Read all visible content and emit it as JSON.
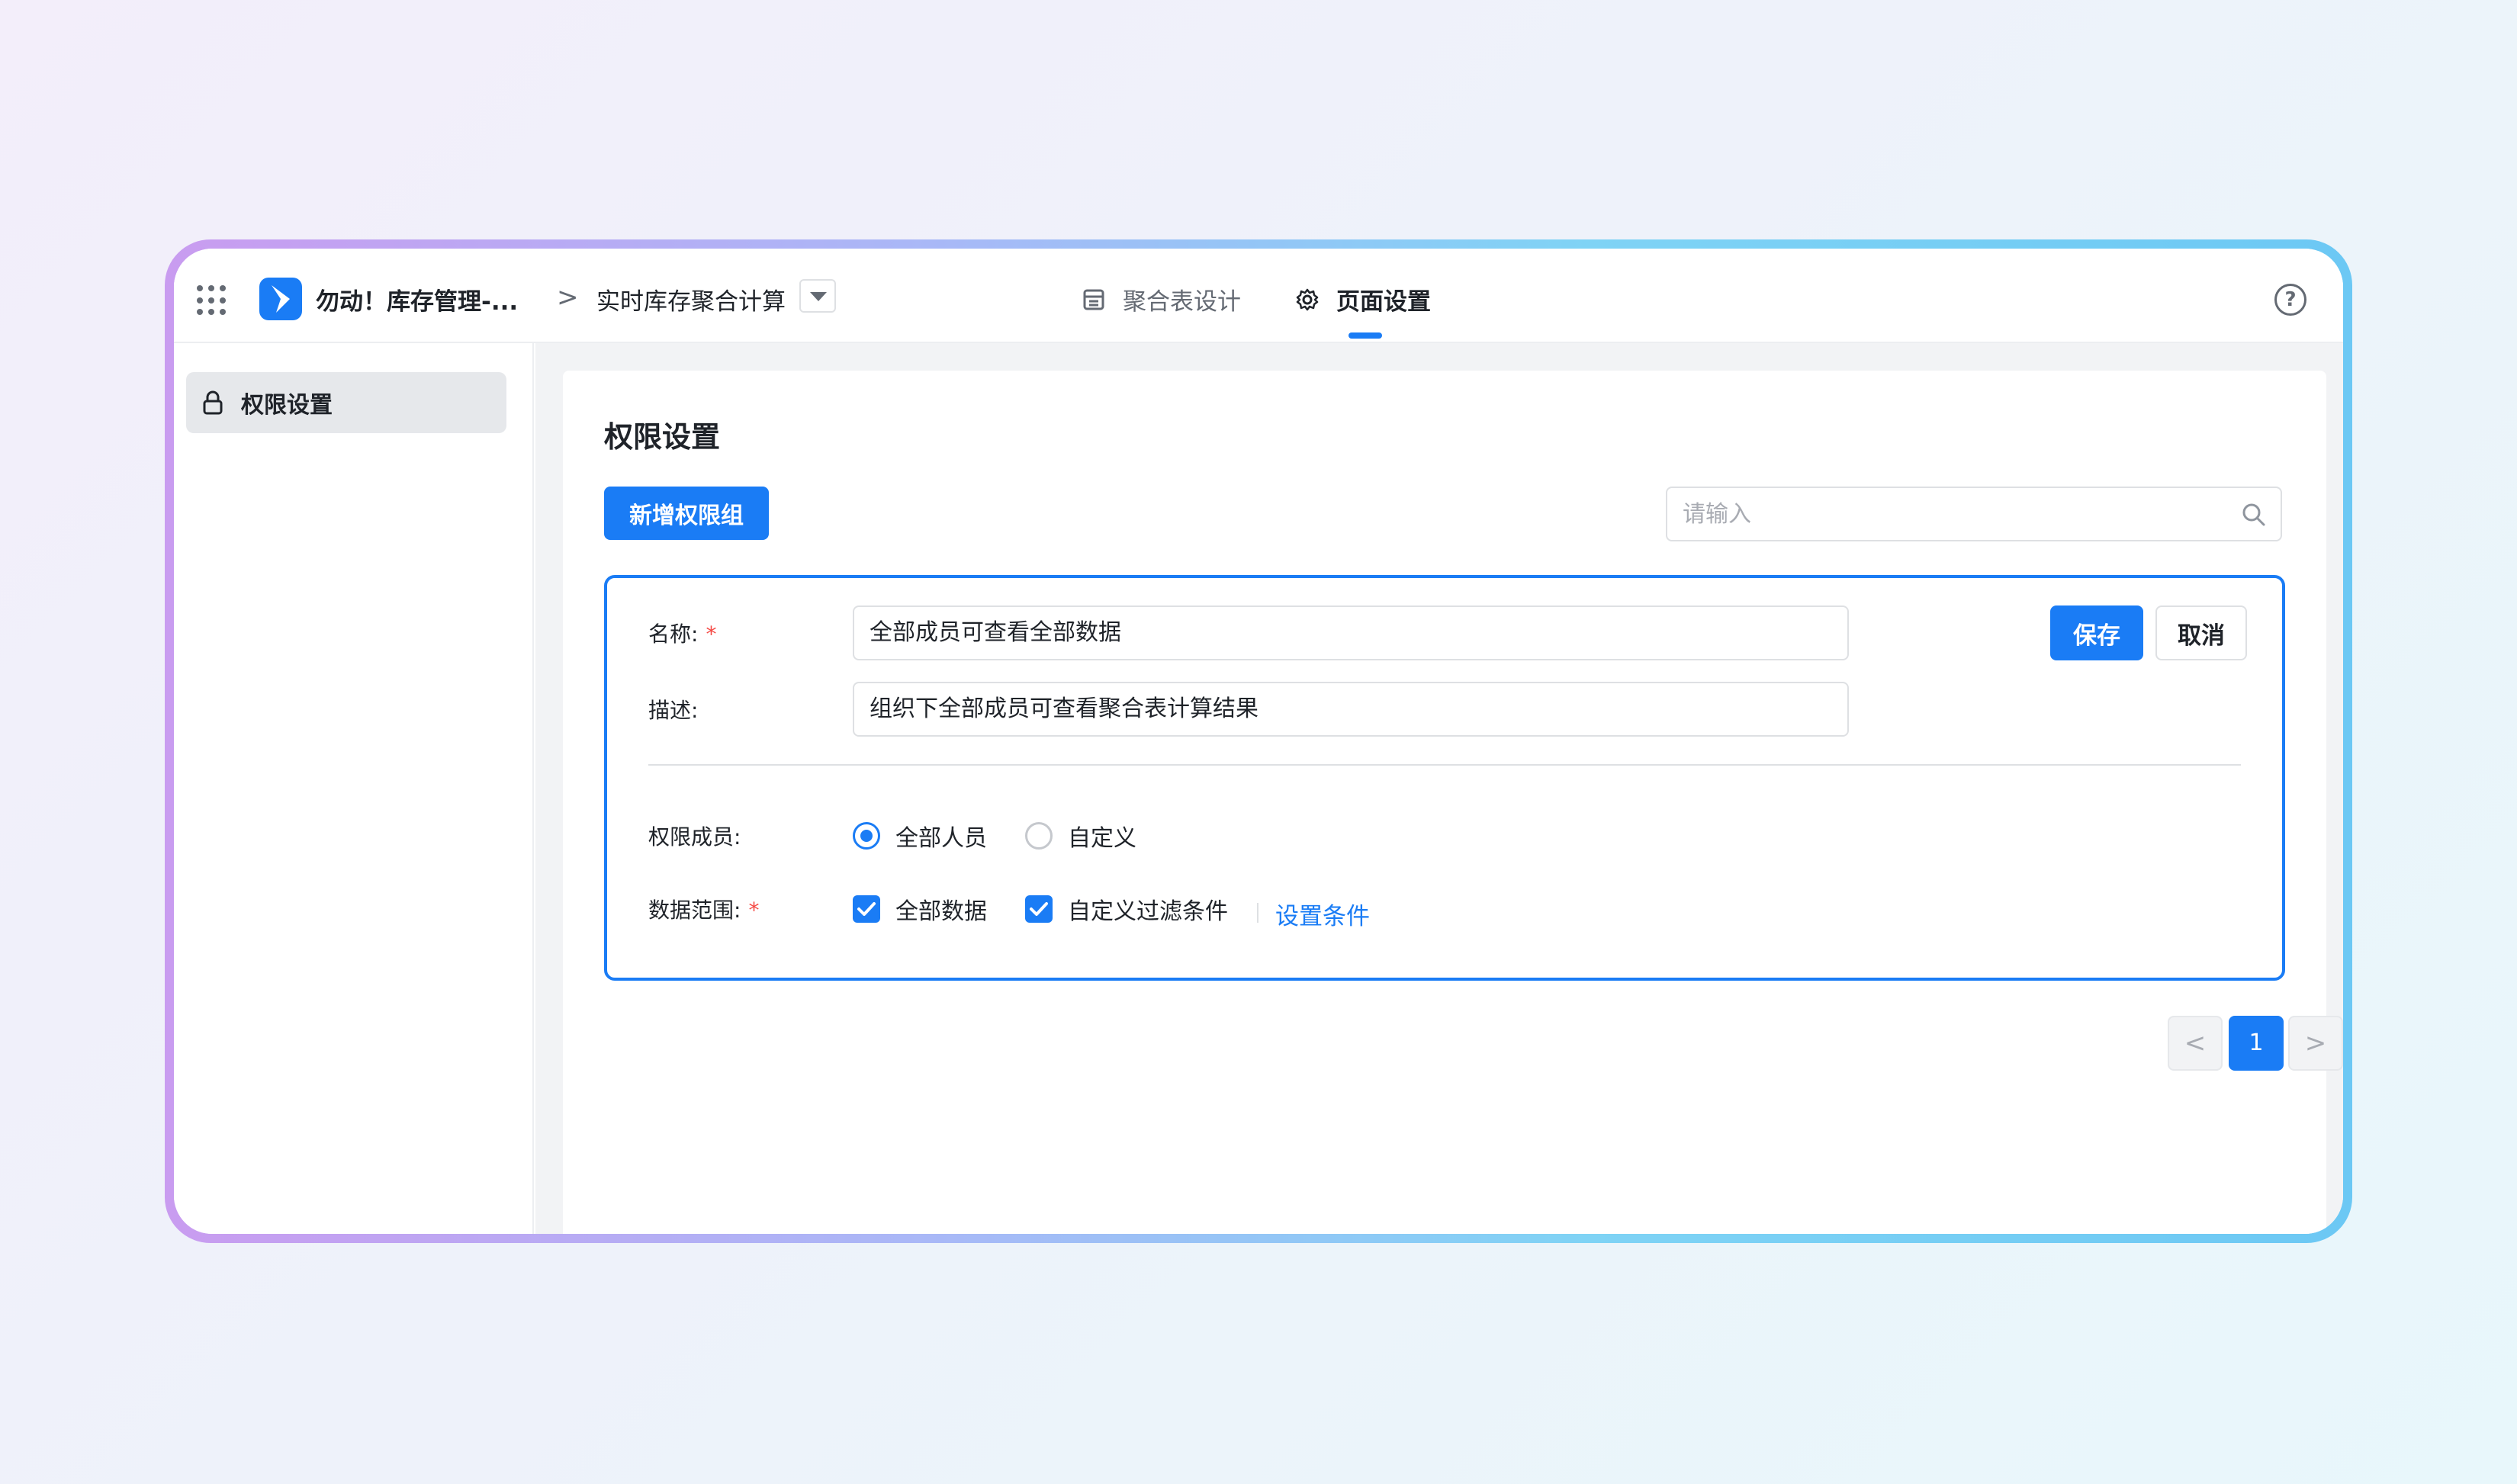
{
  "header": {
    "app_name": "勿动！库存管理-...",
    "breadcrumb_separator": ">",
    "page_name": "实时库存聚合计算",
    "tabs": [
      {
        "label": "聚合表设计",
        "icon": "table-icon",
        "active": false
      },
      {
        "label": "页面设置",
        "icon": "gear-icon",
        "active": true
      }
    ],
    "help_symbol": "?"
  },
  "sidebar": {
    "items": [
      {
        "label": "权限设置",
        "icon": "lock-icon",
        "selected": true
      }
    ]
  },
  "main": {
    "title": "权限设置",
    "add_button": "新增权限组",
    "search": {
      "placeholder": "请输入",
      "value": ""
    },
    "editor": {
      "name_label": "名称:",
      "name_value": "全部成员可查看全部数据",
      "desc_label": "描述:",
      "desc_value": "组织下全部成员可查看聚合表计算结果",
      "save_label": "保存",
      "cancel_label": "取消",
      "members_label": "权限成员:",
      "member_options": [
        {
          "label": "全部人员",
          "selected": true
        },
        {
          "label": "自定义",
          "selected": false
        }
      ],
      "range_label": "数据范围:",
      "range_options": [
        {
          "label": "全部数据",
          "checked": true
        },
        {
          "label": "自定义过滤条件",
          "checked": true
        }
      ],
      "set_condition_link": "设置条件",
      "required_mark": "*"
    },
    "pagination": {
      "prev": "<",
      "current": "1",
      "next": ">"
    }
  },
  "colors": {
    "accent": "#1a7cf5",
    "required": "#f54a45",
    "frame_gradient_start": "#c99cf0",
    "frame_gradient_end": "#6cc8f4"
  }
}
